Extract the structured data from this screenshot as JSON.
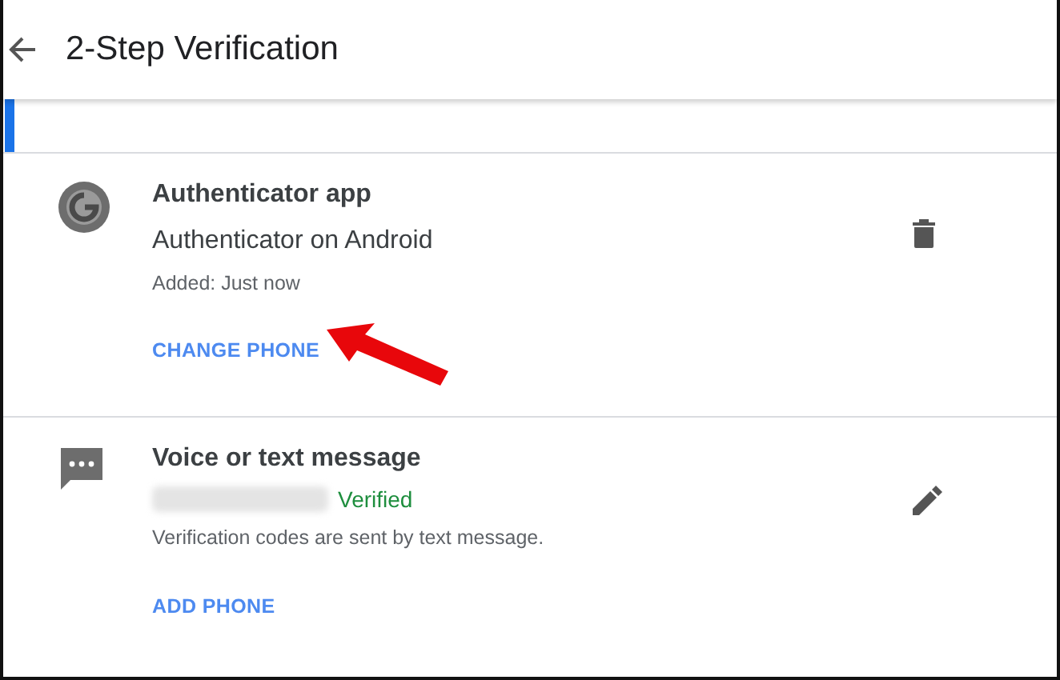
{
  "header": {
    "title": "2-Step Verification"
  },
  "methods": [
    {
      "kind": "app",
      "title": "Authenticator app",
      "device": "Authenticator on Android",
      "note": "Added: Just now",
      "action": "CHANGE PHONE",
      "highlighted": true
    },
    {
      "kind": "sms",
      "title": "Voice or text message",
      "status": "Verified",
      "note": "Verification codes are sent by text message.",
      "action": "ADD PHONE",
      "highlighted": false
    }
  ]
}
